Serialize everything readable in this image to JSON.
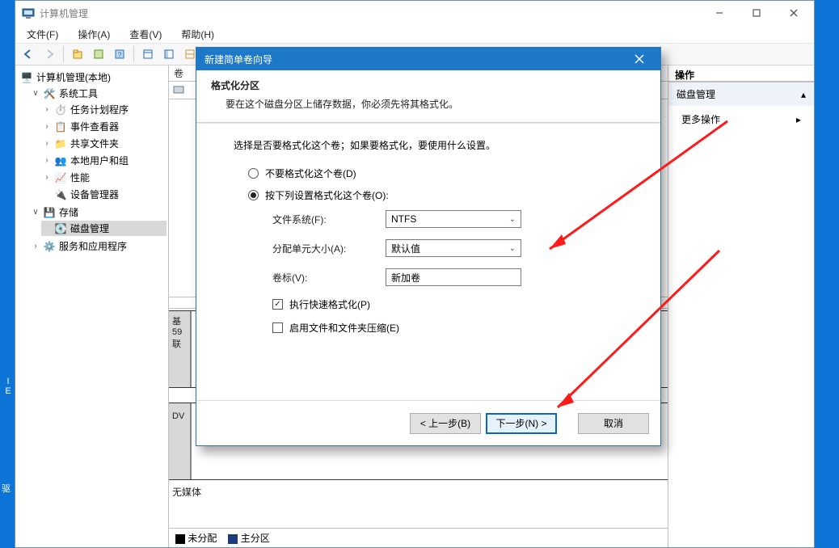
{
  "window": {
    "title": "计算机管理",
    "menus": [
      "文件(F)",
      "操作(A)",
      "查看(V)",
      "帮助(H)"
    ]
  },
  "tree": {
    "root": "计算机管理(本地)",
    "sys_tools": "系统工具",
    "task_scheduler": "任务计划程序",
    "event_viewer": "事件查看器",
    "shared_folders": "共享文件夹",
    "local_users": "本地用户和组",
    "performance": "性能",
    "device_mgr": "设备管理器",
    "storage": "存储",
    "disk_mgmt": "磁盘管理",
    "services": "服务和应用程序"
  },
  "center": {
    "col_volume": "卷",
    "disk_a": {
      "label1": "基",
      "label2": "59",
      "label3": "联"
    },
    "disk_b": {
      "label": "DV"
    },
    "no_media": "无媒体",
    "legend_unalloc": "未分配",
    "legend_primary": "主分区"
  },
  "actions": {
    "header": "操作",
    "disk_mgmt": "磁盘管理",
    "more": "更多操作"
  },
  "wizard": {
    "title": "新建简单卷向导",
    "head_title": "格式化分区",
    "head_sub": "要在这个磁盘分区上储存数据，你必须先将其格式化。",
    "intro": "选择是否要格式化这个卷；如果要格式化，要使用什么设置。",
    "opt_no_format": "不要格式化这个卷(D)",
    "opt_format": "按下列设置格式化这个卷(O):",
    "lab_fs": "文件系统(F):",
    "val_fs": "NTFS",
    "lab_au": "分配单元大小(A):",
    "val_au": "默认值",
    "lab_label": "卷标(V):",
    "val_label": "新加卷",
    "chk_quick": "执行快速格式化(P)",
    "chk_compress": "启用文件和文件夹压缩(E)",
    "btn_back": "< 上一步(B)",
    "btn_next": "下一步(N) >",
    "btn_cancel": "取消"
  },
  "desktop": {
    "i_letter": "I",
    "e_letter": "E",
    "drive_label": "驱"
  }
}
